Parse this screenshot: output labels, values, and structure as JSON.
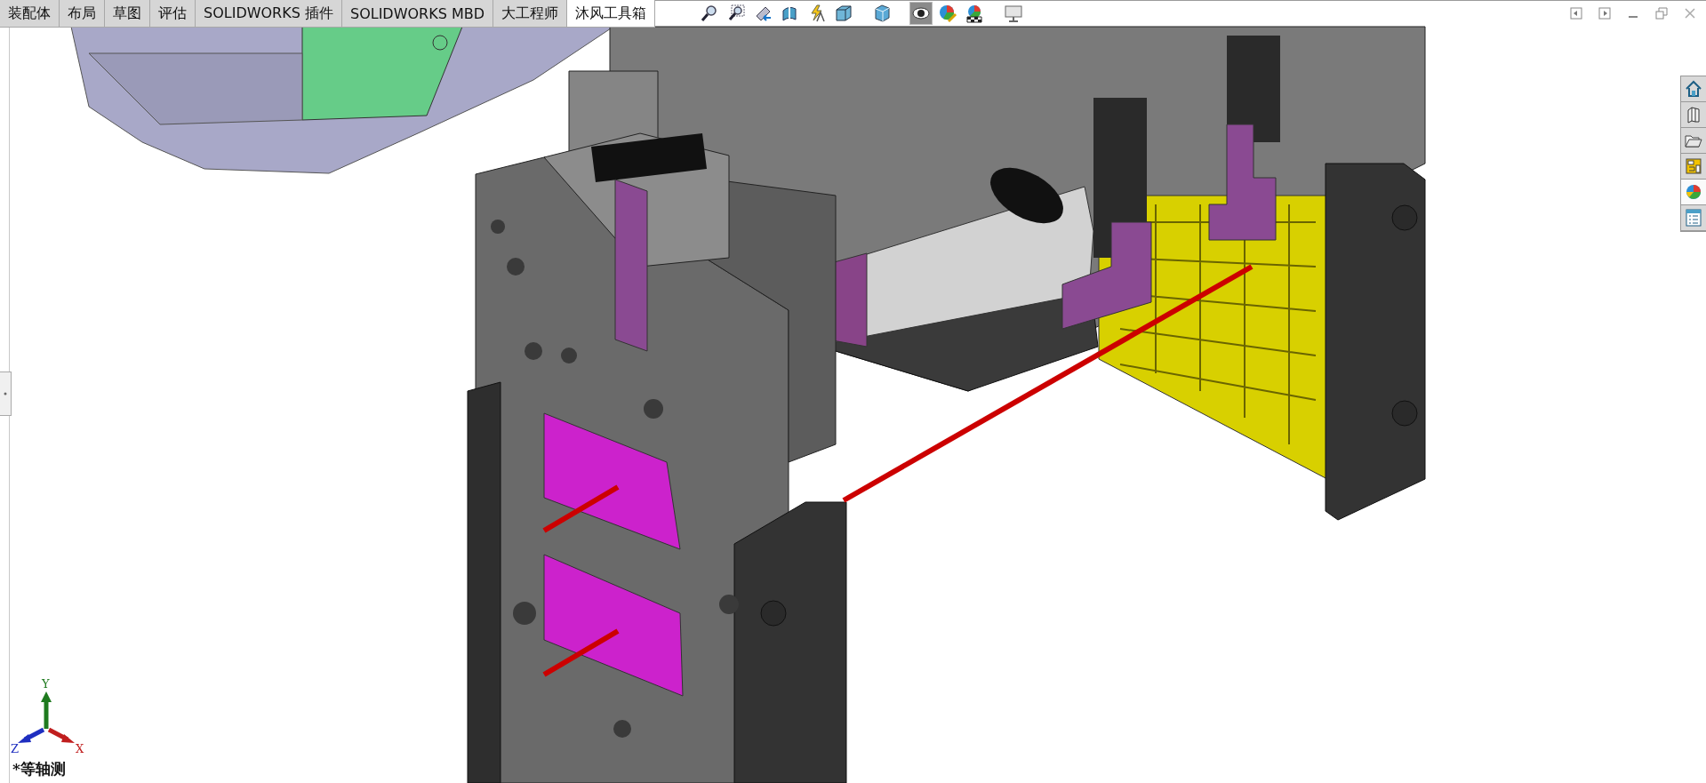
{
  "ribbon_tabs": [
    {
      "label": "装配体",
      "selected": false
    },
    {
      "label": "布局",
      "selected": false
    },
    {
      "label": "草图",
      "selected": false
    },
    {
      "label": "评估",
      "selected": false
    },
    {
      "label": "SOLIDWORKS 插件",
      "selected": false
    },
    {
      "label": "SOLIDWORKS MBD",
      "selected": false
    },
    {
      "label": "大工程师",
      "selected": false
    },
    {
      "label": "沐风工具箱",
      "selected": true
    }
  ],
  "view_toolbar": [
    {
      "kind": "zoom-fit",
      "pressed": false
    },
    {
      "kind": "zoom-area",
      "pressed": false
    },
    {
      "kind": "previous-view",
      "pressed": false
    },
    {
      "kind": "section-view",
      "pressed": false
    },
    {
      "kind": "annotation",
      "pressed": false
    },
    {
      "kind": "view-orientation",
      "pressed": false
    },
    {
      "kind": "display-style",
      "pressed": false
    },
    {
      "kind": "hide-show",
      "pressed": true
    },
    {
      "kind": "edit-appearance",
      "pressed": false
    },
    {
      "kind": "scene",
      "pressed": false
    },
    {
      "kind": "view-settings",
      "pressed": false
    }
  ],
  "task_pane": [
    {
      "kind": "home",
      "selected": false
    },
    {
      "kind": "parts",
      "selected": false
    },
    {
      "kind": "folder",
      "selected": false
    },
    {
      "kind": "layout",
      "selected": false
    },
    {
      "kind": "appearance",
      "selected": true
    },
    {
      "kind": "properties",
      "selected": false
    }
  ],
  "triad": {
    "x_label": "X",
    "y_label": "Y",
    "z_label": "Z"
  },
  "view_name": "*等轴测"
}
